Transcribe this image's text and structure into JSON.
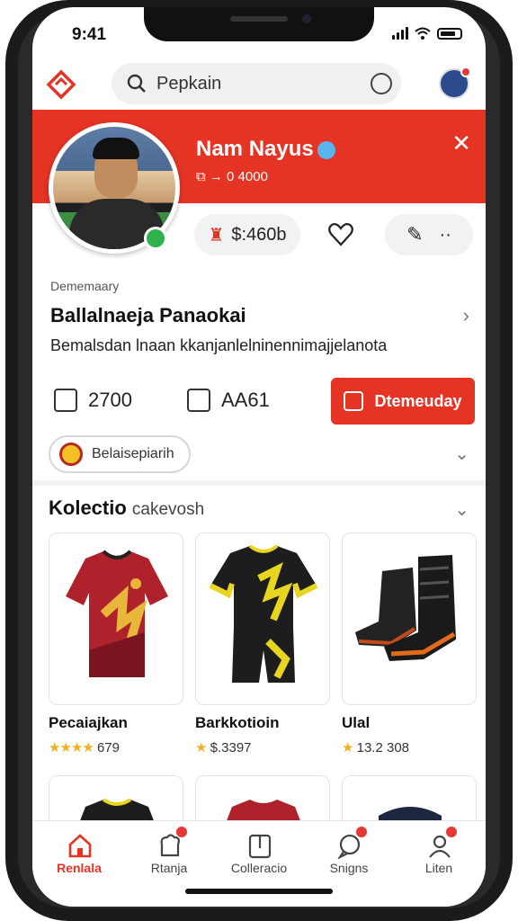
{
  "status_bar": {
    "time": "9:41"
  },
  "search": {
    "placeholder": "Pepkain"
  },
  "profile": {
    "name": "Nam Nayus",
    "subtitle": "⧉ → 0 4000",
    "price": "$:460b",
    "colors": {
      "accent": "#e53324",
      "online": "#2fb24c"
    }
  },
  "section": {
    "label": "Dememaary",
    "title": "Ballalnaeja Panaokai",
    "description": "Bemalsdan lnaan kkanjanlelninennimajjelanota"
  },
  "metrics": {
    "a_value": "2700",
    "b_value": "AA61",
    "cta_label": "Dtemeuday"
  },
  "chip": {
    "label": "Belaisepiarih"
  },
  "collection": {
    "title": "Kolectio",
    "subtitle": "cakevosh",
    "items": [
      {
        "name": "Pecaiajkan",
        "rating": "679",
        "stars": "★★★★"
      },
      {
        "name": "Barkkotioin",
        "rating": "$.3397",
        "stars": "★"
      },
      {
        "name": "Ulal",
        "rating": "13.2 308",
        "stars": "★"
      }
    ]
  },
  "nav": [
    {
      "label": "Renlala",
      "icon": "home-icon"
    },
    {
      "label": "Rtanja",
      "icon": "chef-hat-icon"
    },
    {
      "label": "Colleracio",
      "icon": "folder-icon"
    },
    {
      "label": "Snigns",
      "icon": "chat-icon"
    },
    {
      "label": "Liten",
      "icon": "user-icon"
    }
  ]
}
